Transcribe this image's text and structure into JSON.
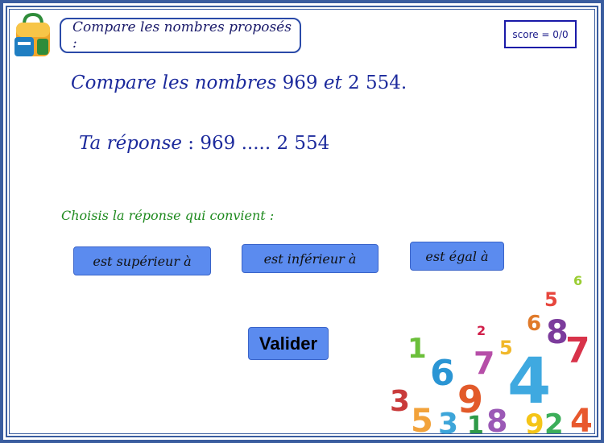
{
  "header": {
    "title": "Compare les nombres proposés :",
    "score": "score = 0/0"
  },
  "question": {
    "prefix": "Compare les nombres",
    "number_a": "969",
    "conjunction": "et",
    "number_b": "2 554",
    "suffix": "."
  },
  "answer": {
    "label": "Ta réponse",
    "separator": ":",
    "number_a": "969",
    "placeholder": ".....",
    "number_b": "2 554"
  },
  "instruction": "Choisis la réponse qui convient :",
  "choices": [
    {
      "label": "est supérieur à"
    },
    {
      "label": "est inférieur à"
    },
    {
      "label": "est égal à"
    }
  ],
  "validate_label": "Valider",
  "decor_digits": [
    "6",
    "2",
    "5",
    "1",
    "4",
    "6",
    "9",
    "7",
    "8",
    "3",
    "5",
    "7",
    "4",
    "3",
    "1",
    "8",
    "9",
    "2",
    "6",
    "5"
  ],
  "colors": {
    "frame": "#3a5d9f",
    "button": "#5b8bef",
    "question_text": "#1c2a9c",
    "instruction_text": "#1e8a1e"
  }
}
